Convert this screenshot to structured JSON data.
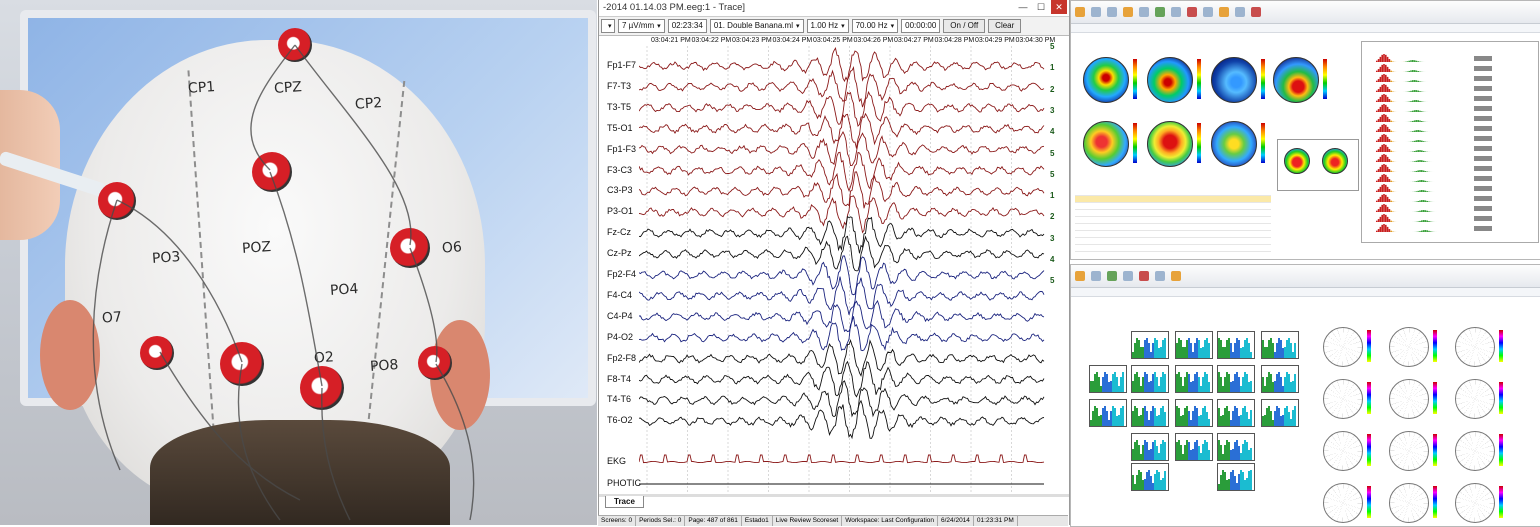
{
  "trace_window": {
    "title": "-2014 01.14.03 PM.eeg:1 - Trace]",
    "toolbar": {
      "sensitivity": "7 µV/mm",
      "time": "02:23:34",
      "montage": "01. Double Banana.ml",
      "low_filter": "1.00 Hz",
      "high_filter": "70.00 Hz",
      "clock": "00:00:00",
      "on_off": "On / Off",
      "clear": "Clear"
    },
    "timestamps": [
      "03:04:21 PM",
      "03:04:22 PM",
      "03:04:23 PM",
      "03:04:24 PM",
      "03:04:25 PM",
      "03:04:26 PM",
      "03:04:27 PM",
      "03:04:28 PM",
      "03:04:29 PM",
      "03:04:30 PM"
    ],
    "channels": [
      {
        "label": "Fp1-F7",
        "group": "red"
      },
      {
        "label": "F7-T3",
        "group": "red"
      },
      {
        "label": "T3-T5",
        "group": "red"
      },
      {
        "label": "T5-O1",
        "group": "red"
      },
      {
        "label": "Fp1-F3",
        "group": "red"
      },
      {
        "label": "F3-C3",
        "group": "red"
      },
      {
        "label": "C3-P3",
        "group": "red"
      },
      {
        "label": "P3-O1",
        "group": "red"
      },
      {
        "label": "Fz-Cz",
        "group": "black"
      },
      {
        "label": "Cz-Pz",
        "group": "black"
      },
      {
        "label": "Fp2-F4",
        "group": "blue"
      },
      {
        "label": "F4-C4",
        "group": "blue"
      },
      {
        "label": "C4-P4",
        "group": "blue"
      },
      {
        "label": "P4-O2",
        "group": "blue"
      },
      {
        "label": "Fp2-F8",
        "group": "black"
      },
      {
        "label": "F8-T4",
        "group": "black"
      },
      {
        "label": "T4-T6",
        "group": "black"
      },
      {
        "label": "T6-O2",
        "group": "black"
      },
      {
        "label": "EKG",
        "group": "ekg"
      },
      {
        "label": "PHOTIC",
        "group": "photic"
      }
    ],
    "montage_numbers": [
      "5",
      "1",
      "2",
      "3",
      "4",
      "5",
      "5",
      "1",
      "2",
      "3",
      "4",
      "5"
    ],
    "tab": "Trace",
    "colors": {
      "red": "#8b1a1a",
      "blue": "#1a237e",
      "black": "#111111",
      "ekg": "#8b1a1a"
    }
  },
  "status_bar": {
    "screens": "Screens: 0",
    "periods": "Periods Sel.: 0",
    "page": "Page: 487 of 861",
    "estado": "Estado1",
    "review": "Live Review Scoreset",
    "workspace": "Workspace: Last Configuration",
    "date": "6/24/2014",
    "clock": "01:23:31 PM"
  },
  "photo": {
    "electrode_labels": [
      "CPZ",
      "CP1",
      "CP2",
      "POZ",
      "PO3",
      "PO4",
      "O7",
      "O2",
      "PO8",
      "O6"
    ]
  }
}
